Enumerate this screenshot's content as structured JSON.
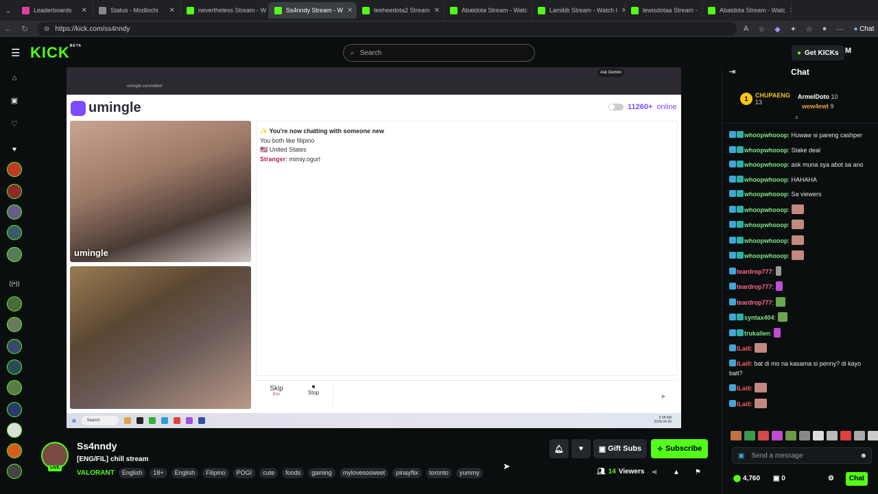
{
  "browser": {
    "tabs": [
      {
        "label": "Leaderboards",
        "color": "#e040a0"
      },
      {
        "label": "Status - Modlochi",
        "color": "#888888"
      },
      {
        "label": "nevertheless Stream - W",
        "color": "#53fc18"
      },
      {
        "label": "Ss4nndy Stream - W",
        "color": "#53fc18",
        "active": true
      },
      {
        "label": "teeheedota2 Stream",
        "color": "#53fc18"
      },
      {
        "label": "Abatdota Stream - Watc",
        "color": "#53fc18"
      },
      {
        "label": "Lamibb Stream - Watch l",
        "color": "#53fc18"
      },
      {
        "label": "lewisdotaa Stream -",
        "color": "#53fc18"
      },
      {
        "label": "Abatdota Stream - Watc",
        "color": "#53fc18"
      }
    ],
    "url": "https://kick.com/ss4nndy",
    "copilot_label": "Chat"
  },
  "header": {
    "logo": "KICK",
    "logo_sup": "BETA",
    "search_placeholder": "Search",
    "get_kicks": "Get KICKs",
    "user_initial": "M"
  },
  "video": {
    "inner_url": "umingle.com/video/",
    "ask_gemini": "Ask Gemini",
    "site_name": "umingle",
    "online_count": "11260+",
    "online_label": "online",
    "cam_watermark": "umingle",
    "chat_lines": {
      "new": "You're now chatting with someone new",
      "like": "You both like filipino",
      "country": "United States",
      "stranger_label": "Stranger:",
      "stranger_name": "mimiy.ogurl"
    },
    "skip": "Skip",
    "skip_key": "Esc",
    "stop": "Stop",
    "taskbar_search": "Search",
    "taskbar_time": "5:38 AM",
    "taskbar_date": "2026-04-26"
  },
  "stream": {
    "channel": "Ss4nndy",
    "title": "[ENG/FIL] chill stream",
    "live": "LIVE",
    "category": "VALORANT",
    "tags": [
      "English",
      "18+",
      "English",
      "Filipino",
      "POGI",
      "cute",
      "foods",
      "gaming",
      "mylovesosweet",
      "pinayflix",
      "toronto",
      "yummy"
    ],
    "gift_subs": "Gift Subs",
    "subscribe": "Subscribe",
    "viewers": "14",
    "viewers_label": "Viewers"
  },
  "chat": {
    "title": "Chat",
    "leader1_rank": "1",
    "leader1_name": "CHUPAENG",
    "leader1_count": "13",
    "leader2_name": "ArmelDoto",
    "leader2_count": "10",
    "leader3_name": "wew4ewt",
    "leader3_count": "9",
    "messages": [
      {
        "user": "whoopwhooop",
        "color": "#7ee787",
        "text": "Huwaw si pareng cashper"
      },
      {
        "user": "whoopwhooop",
        "color": "#7ee787",
        "text": "Stake deal"
      },
      {
        "user": "whoopwhooop",
        "color": "#7ee787",
        "text": "ask muna sya abot sa ano"
      },
      {
        "user": "whoopwhooop",
        "color": "#7ee787",
        "text": "HAHAHA"
      },
      {
        "user": "whoopwhooop",
        "color": "#7ee787",
        "text": "Sa viewers"
      },
      {
        "user": "whoopwhooop",
        "color": "#7ee787",
        "text": "",
        "emote": "emote"
      },
      {
        "user": "whoopwhooop",
        "color": "#7ee787",
        "text": "",
        "emote": "emote"
      },
      {
        "user": "whoopwhooop",
        "color": "#7ee787",
        "text": "",
        "emote": "emote"
      },
      {
        "user": "whoopwhooop",
        "color": "#7ee787",
        "text": "",
        "emote": "emote"
      },
      {
        "user": "teardrop777",
        "color": "#ff6b8a",
        "text": "",
        "emote": "emote gray"
      },
      {
        "user": "teardrop777",
        "color": "#ff6b8a",
        "text": "",
        "emote": "emote purple"
      },
      {
        "user": "teardrop777",
        "color": "#ff6b8a",
        "text": "",
        "emote": "emote green"
      },
      {
        "user": "syntax404",
        "color": "#7ee787",
        "text": "",
        "emote": "emote green"
      },
      {
        "user": "trukallen",
        "color": "#7ee787",
        "text": "",
        "emote": "emote purple"
      },
      {
        "user": "ILaili",
        "color": "#ff5c5c",
        "text": "",
        "emote": "emote"
      },
      {
        "user": "ILaili",
        "color": "#ff5c5c",
        "text": "bat di mo na kasama si penny? di kayo bati?"
      },
      {
        "user": "ILaili",
        "color": "#ff5c5c",
        "text": "",
        "emote": "emote"
      },
      {
        "user": "ILaili",
        "color": "#ff5c5c",
        "text": "",
        "emote": "emote"
      }
    ],
    "send_placeholder": "Send a message",
    "points": "4,760",
    "points2": "0",
    "chat_button": "Chat"
  }
}
